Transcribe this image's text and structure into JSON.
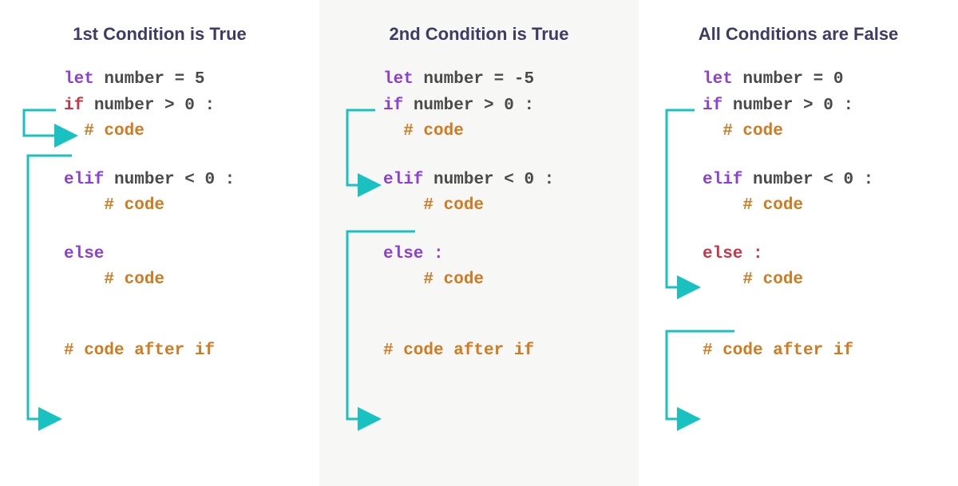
{
  "panels": [
    {
      "title": "1st Condition is True",
      "code": {
        "let": "let",
        "varname": "number",
        "assign": "= 5",
        "if": "if",
        "ifcond": "number > 0 :",
        "ifbody": "# code",
        "elif": "elif",
        "elifcond": "number < 0 :",
        "elifbody": "# code",
        "else": "else",
        "elsebody": "# code",
        "after": "# code after if"
      }
    },
    {
      "title": "2nd Condition is True",
      "code": {
        "let": "let",
        "varname": "number",
        "assign": "= -5",
        "if": "if",
        "ifcond": "number > 0 :",
        "ifbody": "# code",
        "elif": "elif",
        "elifcond": "number < 0 :",
        "elifbody": "# code",
        "else": "else :",
        "elsebody": "# code",
        "after": "# code after if"
      }
    },
    {
      "title": "All Conditions are False",
      "code": {
        "let": "let",
        "varname": "number",
        "assign": "= 0",
        "if": "if",
        "ifcond": "number > 0 :",
        "ifbody": "# code",
        "elif": "elif",
        "elifcond": "number < 0 :",
        "elifbody": "# code",
        "else": "else :",
        "elsebody": "# code",
        "after": "# code after if"
      }
    }
  ],
  "colors": {
    "arrow": "#19c1c1",
    "keyword": "#8a3fd9",
    "highlight": "#c93648",
    "comment": "#d17a1f",
    "title": "#3e3b66"
  }
}
